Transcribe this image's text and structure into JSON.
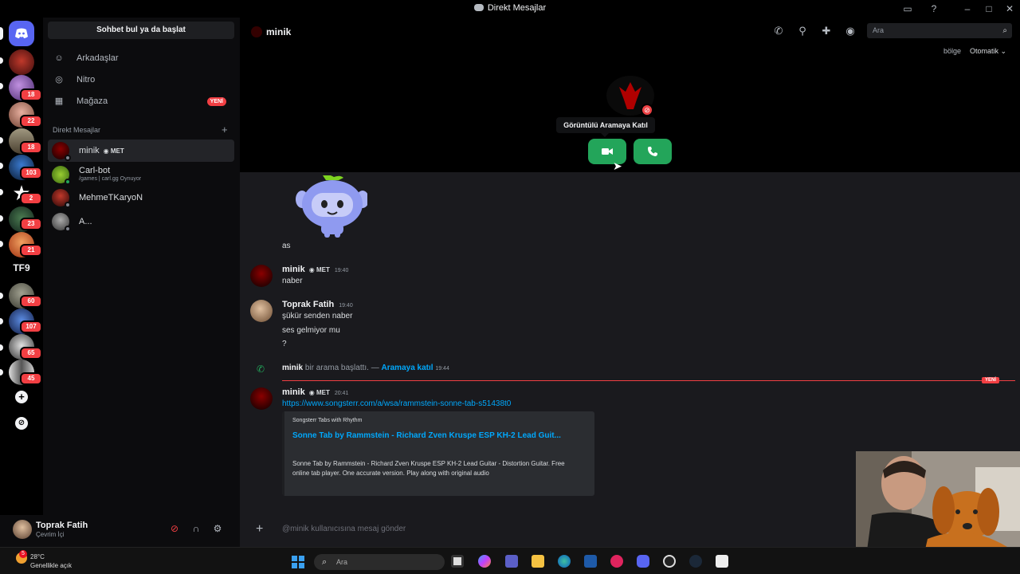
{
  "window": {
    "title": "Direkt Mesajlar"
  },
  "sidebar": {
    "find_button": "Sohbet bul ya da başlat",
    "nav": [
      {
        "label": "Arkadaşlar",
        "icon": "friends-icon"
      },
      {
        "label": "Nitro",
        "icon": "nitro-icon"
      },
      {
        "label": "Mağaza",
        "icon": "shop-icon",
        "badge": "YENİ"
      }
    ],
    "dm_header": "Direkt Mesajlar",
    "dms": [
      {
        "name": "minik",
        "tag": "MET",
        "active": true
      },
      {
        "name": "Carl-bot",
        "sub": "/games | carl.gg Oynuyor"
      },
      {
        "name": "MehmeTKaryoN"
      },
      {
        "name": "A..."
      }
    ]
  },
  "servers": {
    "badges": [
      "18",
      "22",
      "18",
      "103",
      "2",
      "23",
      "21",
      "60",
      "107",
      "65",
      "45"
    ],
    "text_server": "TF9"
  },
  "user_panel": {
    "name": "Toprak Fatih",
    "status": "Çevrim İçi"
  },
  "header": {
    "channel": "minik",
    "search_placeholder": "Ara",
    "region_label": "bölge",
    "region_value": "Otomatik"
  },
  "call": {
    "tooltip": "Görüntülü Aramaya Katıl"
  },
  "messages": {
    "sticker_caption": "as",
    "m1": {
      "author": "minik",
      "tag": "MET",
      "time": "19:40",
      "lines": [
        "naber"
      ]
    },
    "m2": {
      "author": "Toprak Fatih",
      "time": "19:40",
      "lines": [
        "şükür senden naber",
        "ses gelmiyor mu",
        "?"
      ]
    },
    "call_event": {
      "author": "minik",
      "text": "bir arama başlattı. —",
      "join": "Aramaya katıl",
      "time": "19:44"
    },
    "new_marker": "YENİ",
    "m3": {
      "author": "minik",
      "tag": "MET",
      "time": "20:41",
      "link": "https://www.songsterr.com/a/wsa/rammstein-sonne-tab-s51438t0",
      "embed": {
        "provider": "Songsterr Tabs with Rhythm",
        "title": "Sonne Tab by Rammstein - Richard Zven Kruspe   ESP KH-2   Lead Guit...",
        "description": "Sonne Tab by Rammstein - Richard Zven Kruspe ESP KH-2 Lead Guitar - Distortion Guitar. Free online tab player. One accurate version. Play along with original audio"
      }
    }
  },
  "composer": {
    "placeholder": "@minik kullanıcısına mesaj gönder"
  },
  "taskbar": {
    "weather_temp": "28°C",
    "weather_text": "Genellikle açık",
    "weather_badge": "5",
    "search_placeholder": "Ara"
  }
}
